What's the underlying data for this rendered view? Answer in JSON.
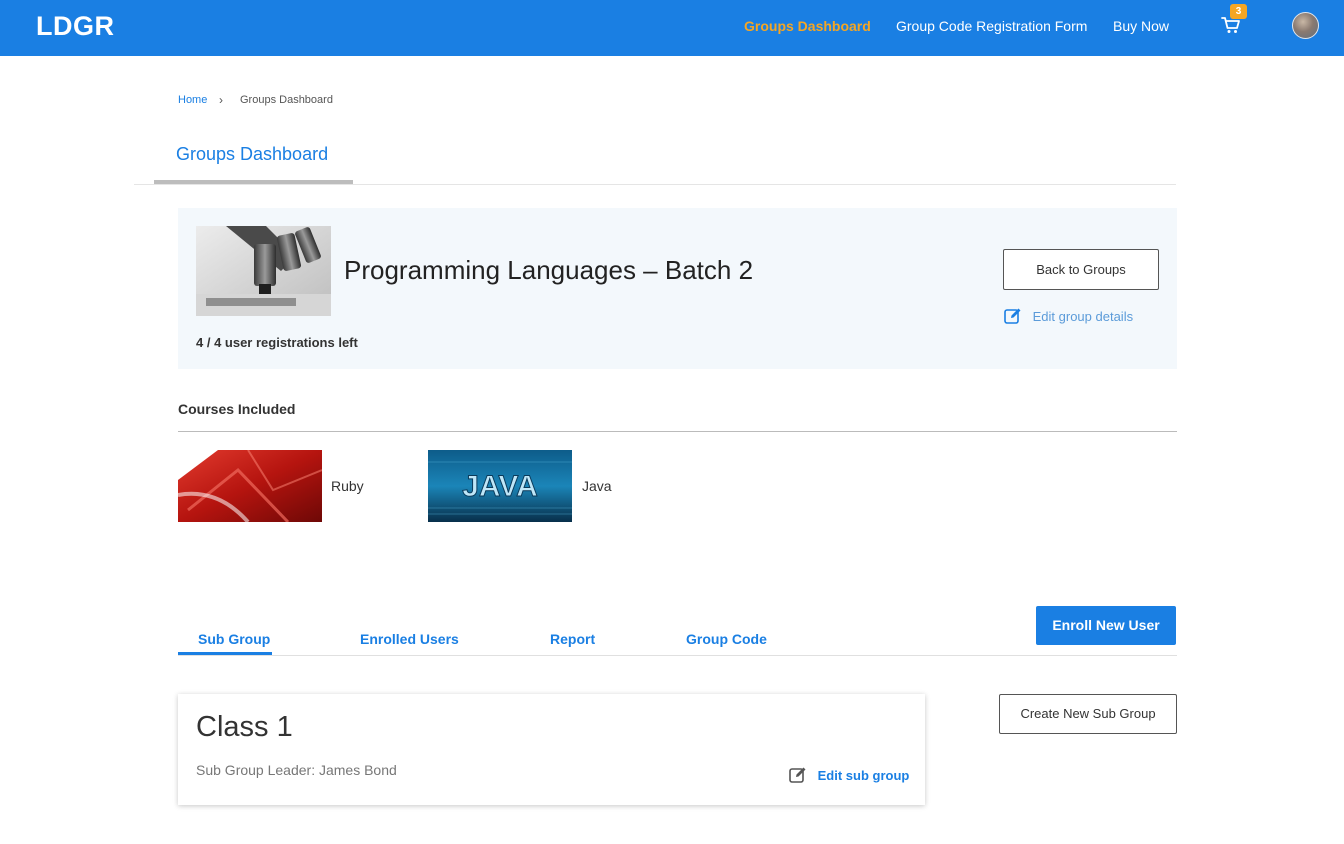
{
  "header": {
    "logo": "LDGR",
    "nav": [
      "Groups Dashboard",
      "Group Code Registration Form",
      "Buy Now"
    ],
    "cart_count": "3",
    "accent": "#1a7fe3",
    "active_color": "#f5a623"
  },
  "breadcrumb": {
    "home": "Home",
    "separator": "›",
    "current": "Groups Dashboard"
  },
  "page_tab": "Groups Dashboard",
  "group": {
    "title": "Programming Languages – Batch 2",
    "registrations": "4 / 4 user registrations left",
    "back_button": "Back to Groups",
    "edit_link": "Edit group details",
    "image_icon": "microscope-image"
  },
  "courses": {
    "heading": "Courses Included",
    "items": [
      {
        "name": "Ruby",
        "icon": "ruby-logo"
      },
      {
        "name": "Java",
        "icon": "java-banner",
        "image_text": "JAVA"
      }
    ]
  },
  "tabs": [
    "Sub Group",
    "Enrolled Users",
    "Report",
    "Group Code"
  ],
  "enroll_button": "Enroll New User",
  "subgroup": {
    "title": "Class 1",
    "leader": "Sub Group Leader: James Bond",
    "edit_link": "Edit sub group",
    "create_button": "Create New Sub Group"
  }
}
